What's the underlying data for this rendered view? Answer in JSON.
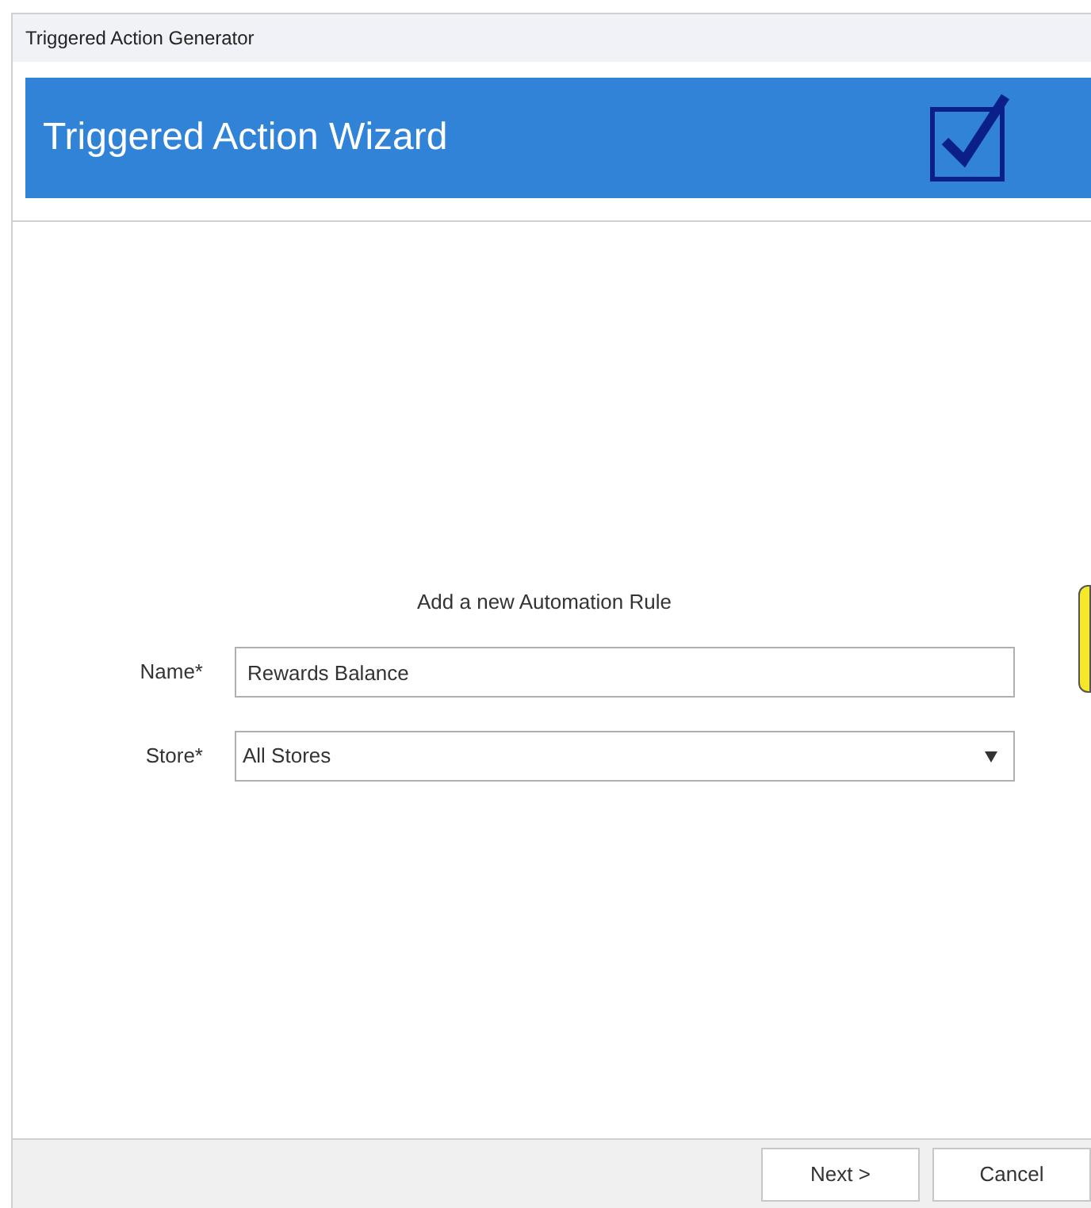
{
  "window": {
    "title": "Triggered Action Generator"
  },
  "banner": {
    "title": "Triggered Action Wizard"
  },
  "form": {
    "heading": "Add a new Automation Rule",
    "fields": [
      {
        "kind": "text",
        "label": "Name*",
        "value": "Rewards Balance"
      },
      {
        "kind": "dropdown",
        "label": "Store*",
        "value": "All Stores"
      }
    ]
  },
  "buttons": [
    "Next >",
    "Cancel"
  ]
}
